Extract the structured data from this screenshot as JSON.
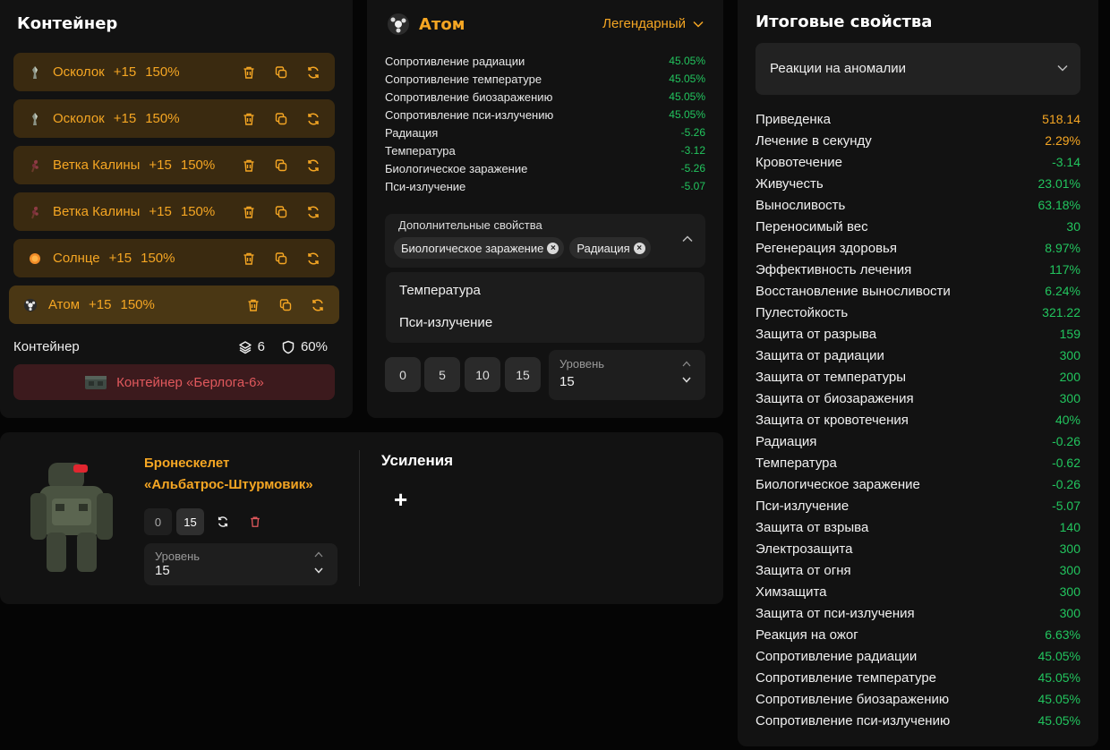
{
  "colors": {
    "accent": "#f5a623",
    "positive": "#22c55e",
    "danger": "#e0585c"
  },
  "container": {
    "title": "Контейнер",
    "slots": [
      {
        "icon": "shard-icon",
        "name": "Осколок",
        "plus": "+15",
        "pct": "150%"
      },
      {
        "icon": "shard-icon",
        "name": "Осколок",
        "plus": "+15",
        "pct": "150%"
      },
      {
        "icon": "viburnum-branch-icon",
        "name": "Ветка Калины",
        "plus": "+15",
        "pct": "150%"
      },
      {
        "icon": "viburnum-branch-icon",
        "name": "Ветка Калины",
        "plus": "+15",
        "pct": "150%"
      },
      {
        "icon": "sun-icon",
        "name": "Солнце",
        "plus": "+15",
        "pct": "150%"
      },
      {
        "icon": "atom-icon",
        "name": "Атом",
        "plus": "+15",
        "pct": "150%"
      }
    ],
    "footer_label": "Контейнер",
    "slots_count": "6",
    "protection": "60%",
    "container_button": "Контейнер «Берлога-6»"
  },
  "artifact": {
    "name": "Атом",
    "rarity": "Легендарный",
    "stats": [
      {
        "label": "Сопротивление радиации",
        "value": "45.05%"
      },
      {
        "label": "Сопротивление температуре",
        "value": "45.05%"
      },
      {
        "label": "Сопротивление биозаражению",
        "value": "45.05%"
      },
      {
        "label": "Сопротивление пси-излучению",
        "value": "45.05%"
      },
      {
        "label": "Радиация",
        "value": "-5.26"
      },
      {
        "label": "Температура",
        "value": "-3.12"
      },
      {
        "label": "Биологическое заражение",
        "value": "-5.26"
      },
      {
        "label": "Пси-излучение",
        "value": "-5.07"
      }
    ],
    "extra_label": "Дополнительные свойства",
    "chips": [
      "Биологическое заражение",
      "Радиация"
    ],
    "options": [
      "Температура",
      "Пси-излучение"
    ],
    "level_buttons": [
      "0",
      "5",
      "10",
      "15"
    ],
    "level_label": "Уровень",
    "level_value": "15"
  },
  "armor": {
    "name_line1": "Бронескелет",
    "name_line2": "«Альбатрос-Штурмовик»",
    "btn_zero": "0",
    "btn_fifteen": "15",
    "level_label": "Уровень",
    "level_value": "15",
    "boosts_title": "Усиления",
    "add_symbol": "+"
  },
  "summary": {
    "title": "Итоговые свойства",
    "select": "Реакции на аномалии",
    "rows": [
      {
        "label": "Приведенка",
        "value": "518.14",
        "color": "#f5a623"
      },
      {
        "label": "Лечение в секунду",
        "value": "2.29%",
        "color": "#f5a623"
      },
      {
        "label": "Кровотечение",
        "value": "-3.14",
        "color": "#22c55e"
      },
      {
        "label": "Живучесть",
        "value": "23.01%",
        "color": "#22c55e"
      },
      {
        "label": "Выносливость",
        "value": "63.18%",
        "color": "#22c55e"
      },
      {
        "label": "Переносимый вес",
        "value": "30",
        "color": "#22c55e"
      },
      {
        "label": "Регенерация здоровья",
        "value": "8.97%",
        "color": "#22c55e"
      },
      {
        "label": "Эффективность лечения",
        "value": "117%",
        "color": "#22c55e"
      },
      {
        "label": "Восстановление выносливости",
        "value": "6.24%",
        "color": "#22c55e"
      },
      {
        "label": "Пулестойкость",
        "value": "321.22",
        "color": "#22c55e"
      },
      {
        "label": "Защита от разрыва",
        "value": "159",
        "color": "#22c55e"
      },
      {
        "label": "Защита от радиации",
        "value": "300",
        "color": "#22c55e"
      },
      {
        "label": "Защита от температуры",
        "value": "200",
        "color": "#22c55e"
      },
      {
        "label": "Защита от биозаражения",
        "value": "300",
        "color": "#22c55e"
      },
      {
        "label": "Защита от кровотечения",
        "value": "40%",
        "color": "#22c55e"
      },
      {
        "label": "Радиация",
        "value": "-0.26",
        "color": "#22c55e"
      },
      {
        "label": "Температура",
        "value": "-0.62",
        "color": "#22c55e"
      },
      {
        "label": "Биологическое заражение",
        "value": "-0.26",
        "color": "#22c55e"
      },
      {
        "label": "Пси-излучение",
        "value": "-5.07",
        "color": "#22c55e"
      },
      {
        "label": "Защита от взрыва",
        "value": "140",
        "color": "#22c55e"
      },
      {
        "label": "Электрозащита",
        "value": "300",
        "color": "#22c55e"
      },
      {
        "label": "Защита от огня",
        "value": "300",
        "color": "#22c55e"
      },
      {
        "label": "Химзащита",
        "value": "300",
        "color": "#22c55e"
      },
      {
        "label": "Защита от пси-излучения",
        "value": "300",
        "color": "#22c55e"
      },
      {
        "label": "Реакция на ожог",
        "value": "6.63%",
        "color": "#22c55e"
      },
      {
        "label": "Сопротивление радиации",
        "value": "45.05%",
        "color": "#22c55e"
      },
      {
        "label": "Сопротивление температуре",
        "value": "45.05%",
        "color": "#22c55e"
      },
      {
        "label": "Сопротивление биозаражению",
        "value": "45.05%",
        "color": "#22c55e"
      },
      {
        "label": "Сопротивление пси-излучению",
        "value": "45.05%",
        "color": "#22c55e"
      }
    ]
  }
}
